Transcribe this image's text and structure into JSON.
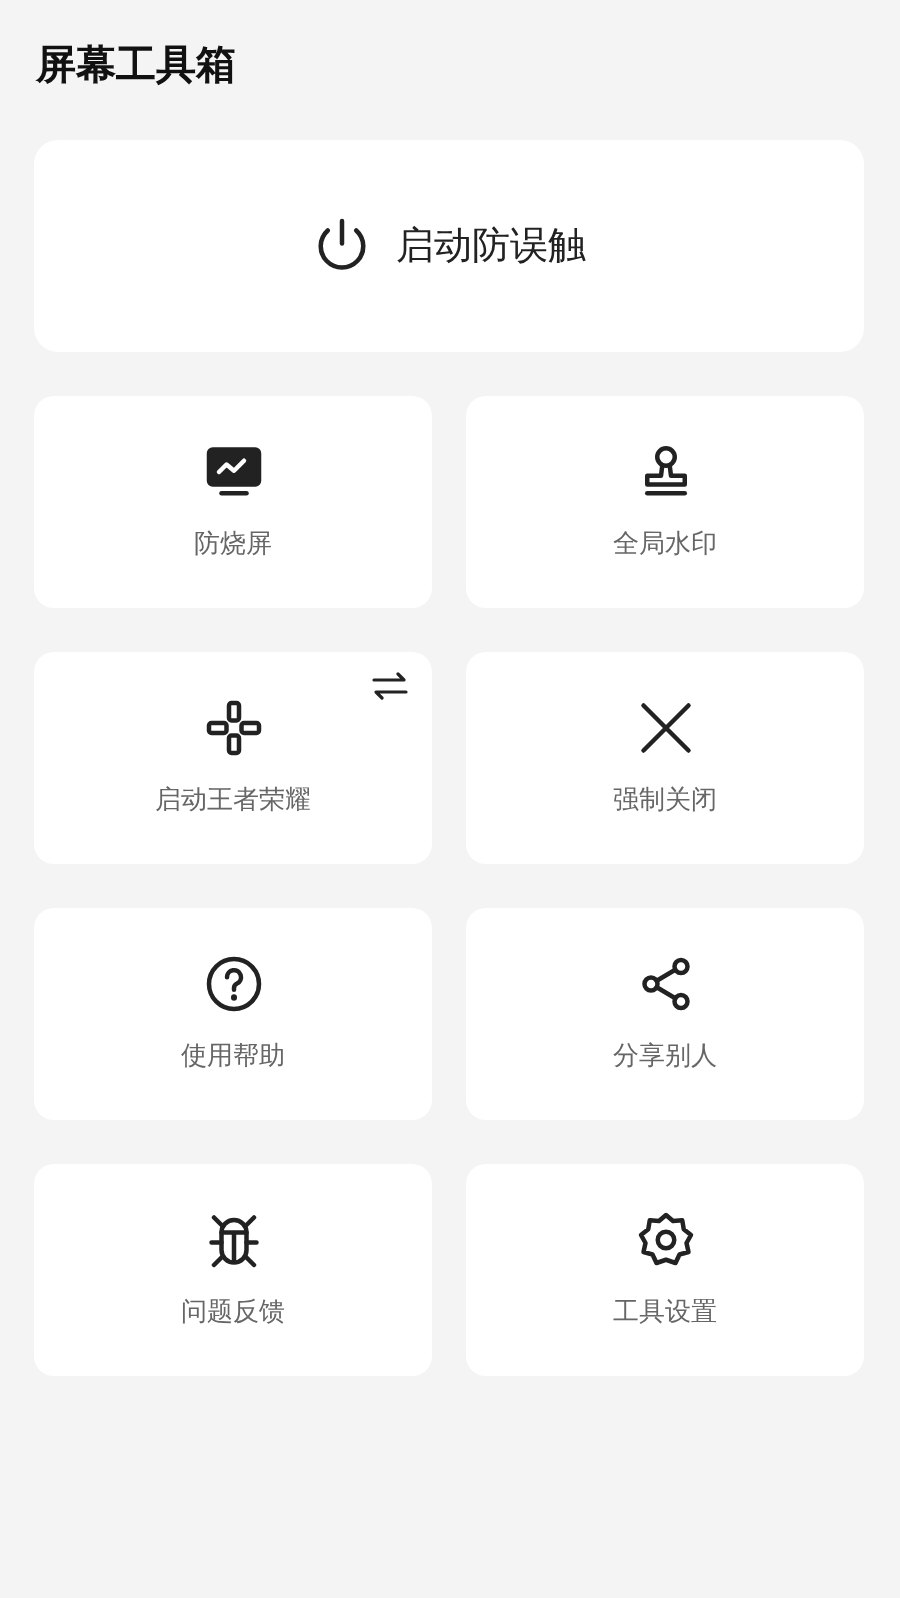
{
  "title": "屏幕工具箱",
  "main_button": {
    "label": "启动防误触"
  },
  "tools": [
    {
      "label": "防烧屏",
      "swap": false
    },
    {
      "label": "全局水印",
      "swap": false
    },
    {
      "label": "启动王者荣耀",
      "swap": true
    },
    {
      "label": "强制关闭",
      "swap": false
    },
    {
      "label": "使用帮助",
      "swap": false
    },
    {
      "label": "分享别人",
      "swap": false
    },
    {
      "label": "问题反馈",
      "swap": false
    },
    {
      "label": "工具设置",
      "swap": false
    }
  ]
}
